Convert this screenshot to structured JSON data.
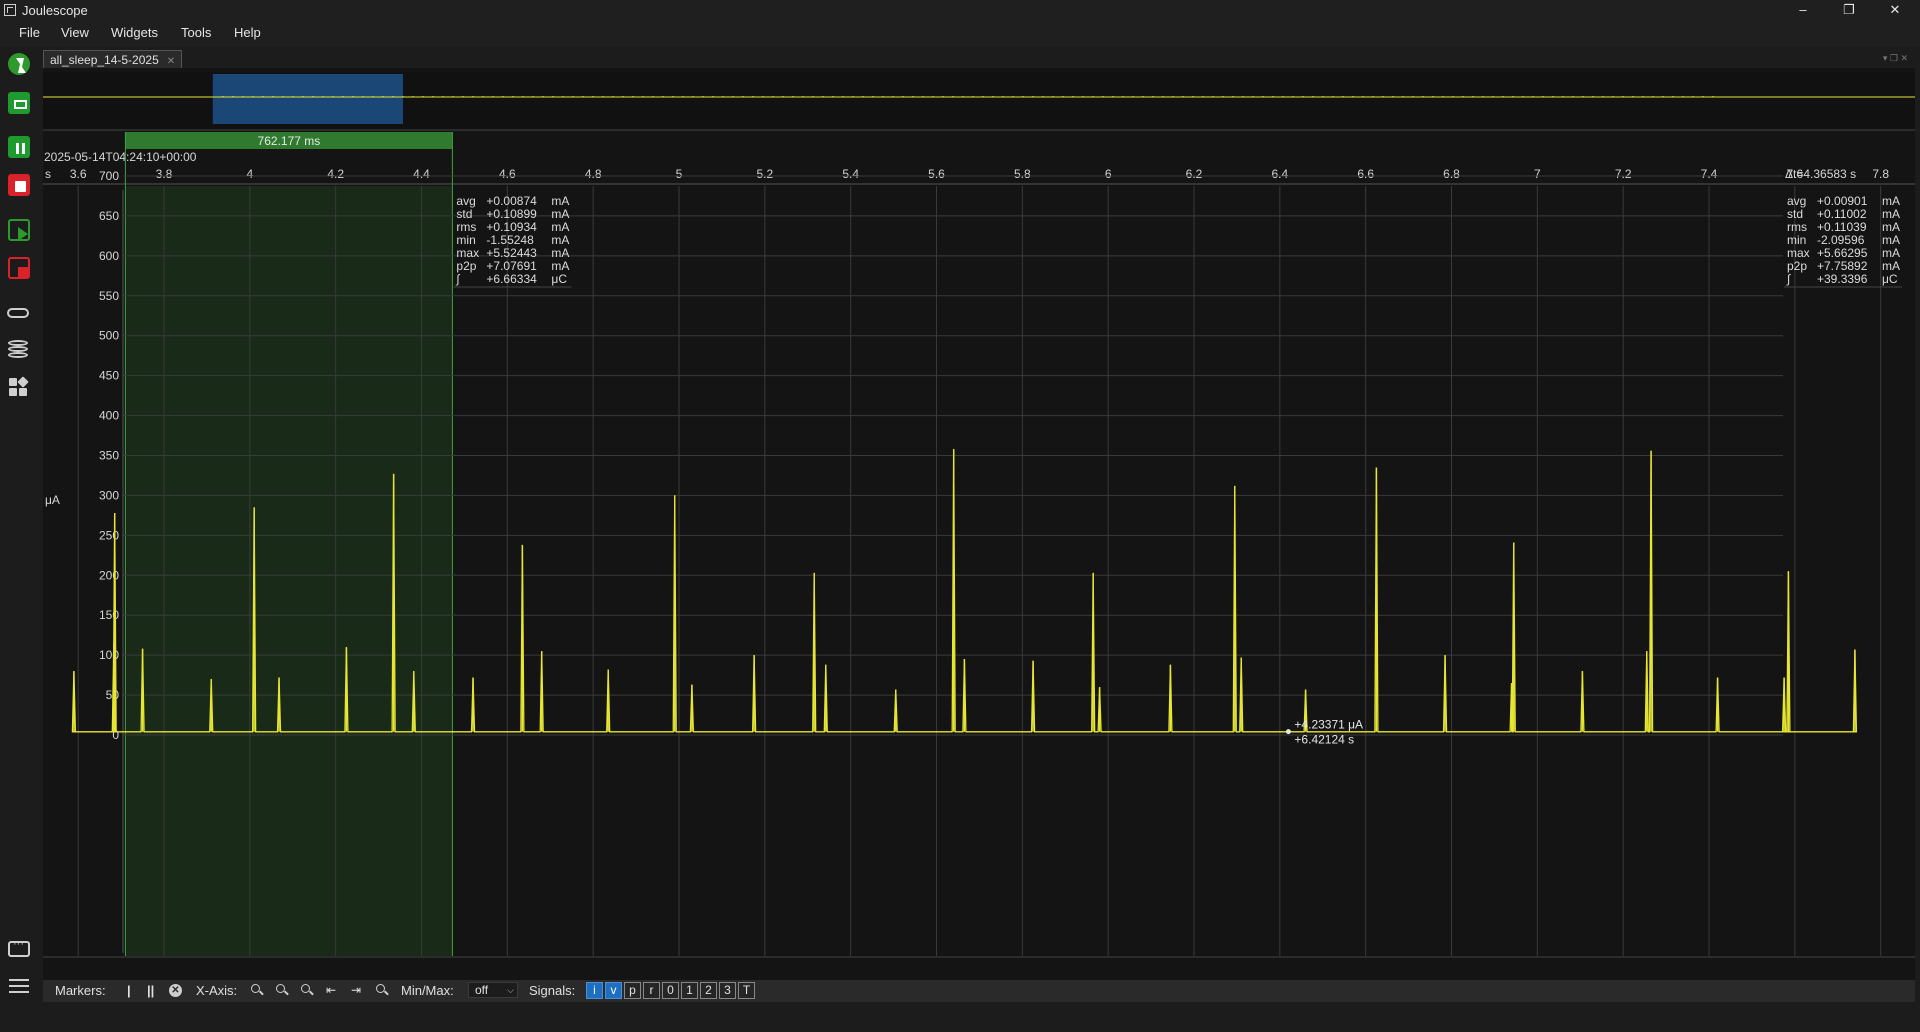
{
  "window": {
    "title": "Joulescope",
    "min": "–",
    "restore": "❐",
    "close": "✕"
  },
  "menu": [
    "File",
    "View",
    "Widgets",
    "Tools",
    "Help"
  ],
  "tab": {
    "label": "all_sleep_14-5-2025",
    "close": "✕"
  },
  "sidebar_icons": [
    "power-icon",
    "screen-icon",
    "pause-icon",
    "stop-icon",
    "play-icon",
    "record-stop-icon",
    "device-icon",
    "database-icon",
    "widgets-icon",
    "chat-icon",
    "menu-icon"
  ],
  "colors": {
    "trace": "#e6e633",
    "accent_green": "#2e9a2e",
    "accent_red": "#d9222a",
    "selection_blue": "#1f5a99",
    "dual_marker_fill": "#2f7a2f"
  },
  "overview": {
    "selection_start_frac": 0.1,
    "selection_end_frac": 0.2
  },
  "xaxis": {
    "timestamp": "2025-05-14T04:24:10+00:00",
    "unit": "s",
    "ticks": [
      "3.6",
      "3.8",
      "4",
      "4.2",
      "4.4",
      "4.6",
      "4.8",
      "5",
      "5.2",
      "5.4",
      "5.6",
      "5.8",
      "6",
      "6.2",
      "6.4",
      "6.6",
      "6.8",
      "7",
      "7.2",
      "7.4",
      "7.6",
      "7.8"
    ],
    "range": [
      3.518,
      7.88
    ],
    "delta_label": "Δt=4.36583 s"
  },
  "dual_marker": {
    "label": "762.177 ms",
    "x1": 3.71,
    "x2": 4.472
  },
  "marker_stats": {
    "rows": [
      {
        "k": "avg",
        "v": "+0.00874",
        "u": "mA"
      },
      {
        "k": "std",
        "v": "+0.10899",
        "u": "mA"
      },
      {
        "k": "rms",
        "v": "+0.10934",
        "u": "mA"
      },
      {
        "k": "min",
        "v": "-1.55248",
        "u": "mA"
      },
      {
        "k": "max",
        "v": "+5.52443",
        "u": "mA"
      },
      {
        "k": "p2p",
        "v": "+7.07691",
        "u": "mA"
      },
      {
        "k": "∫",
        "v": "+6.66334",
        "u": "μC"
      }
    ]
  },
  "view_stats": {
    "rows": [
      {
        "k": "avg",
        "v": "+0.00901",
        "u": "mA"
      },
      {
        "k": "std",
        "v": "+0.11002",
        "u": "mA"
      },
      {
        "k": "rms",
        "v": "+0.11039",
        "u": "mA"
      },
      {
        "k": "min",
        "v": "-2.09596",
        "u": "mA"
      },
      {
        "k": "max",
        "v": "+5.66295",
        "u": "mA"
      },
      {
        "k": "p2p",
        "v": "+7.75892",
        "u": "mA"
      },
      {
        "k": "∫",
        "v": "+39.3396",
        "u": "μC"
      }
    ]
  },
  "yaxis": {
    "unit": "μA",
    "ticks": [
      "700",
      "650",
      "600",
      "550",
      "500",
      "450",
      "400",
      "350",
      "300",
      "250",
      "200",
      "150",
      "100",
      "50",
      "0"
    ],
    "range": [
      0,
      700
    ]
  },
  "cursor": {
    "value": "+4.23371 μA",
    "time": "+6.42124 s",
    "t": 6.42,
    "v": 4.2
  },
  "chart_data": {
    "type": "line",
    "ylabel": "μA",
    "baseline": 4,
    "pulses": [
      {
        "t": 3.59,
        "v": 80
      },
      {
        "t": 3.685,
        "v": 278
      },
      {
        "t": 3.683,
        "v": 115
      },
      {
        "t": 3.75,
        "v": 108
      },
      {
        "t": 3.91,
        "v": 70
      },
      {
        "t": 4.01,
        "v": 285
      },
      {
        "t": 4.068,
        "v": 72
      },
      {
        "t": 4.225,
        "v": 110
      },
      {
        "t": 4.335,
        "v": 327
      },
      {
        "t": 4.382,
        "v": 80
      },
      {
        "t": 4.52,
        "v": 72
      },
      {
        "t": 4.635,
        "v": 238
      },
      {
        "t": 4.68,
        "v": 105
      },
      {
        "t": 4.835,
        "v": 82
      },
      {
        "t": 4.99,
        "v": 300
      },
      {
        "t": 5.03,
        "v": 63
      },
      {
        "t": 5.175,
        "v": 100
      },
      {
        "t": 5.315,
        "v": 203
      },
      {
        "t": 5.342,
        "v": 88
      },
      {
        "t": 5.505,
        "v": 57
      },
      {
        "t": 5.64,
        "v": 358
      },
      {
        "t": 5.665,
        "v": 95
      },
      {
        "t": 5.825,
        "v": 93
      },
      {
        "t": 5.965,
        "v": 203
      },
      {
        "t": 5.98,
        "v": 60
      },
      {
        "t": 6.145,
        "v": 88
      },
      {
        "t": 6.295,
        "v": 312
      },
      {
        "t": 6.31,
        "v": 97
      },
      {
        "t": 6.46,
        "v": 57
      },
      {
        "t": 6.625,
        "v": 335
      },
      {
        "t": 6.785,
        "v": 100
      },
      {
        "t": 6.945,
        "v": 241
      },
      {
        "t": 6.94,
        "v": 65
      },
      {
        "t": 7.105,
        "v": 80
      },
      {
        "t": 7.265,
        "v": 356
      },
      {
        "t": 7.255,
        "v": 105
      },
      {
        "t": 7.42,
        "v": 72
      },
      {
        "t": 7.585,
        "v": 205
      },
      {
        "t": 7.575,
        "v": 72
      },
      {
        "t": 7.74,
        "v": 107
      }
    ]
  },
  "statusbar": {
    "markers_label": "Markers:",
    "xaxis_label": "X-Axis:",
    "minmax_label": "Min/Max:",
    "minmax_value": "off",
    "signals_label": "Signals:",
    "signals": [
      {
        "k": "i",
        "on": true
      },
      {
        "k": "v",
        "on": true
      },
      {
        "k": "p",
        "on": false
      },
      {
        "k": "r",
        "on": false
      },
      {
        "k": "0",
        "on": false
      },
      {
        "k": "1",
        "on": false
      },
      {
        "k": "2",
        "on": false
      },
      {
        "k": "3",
        "on": false
      },
      {
        "k": "T",
        "on": false
      }
    ]
  }
}
